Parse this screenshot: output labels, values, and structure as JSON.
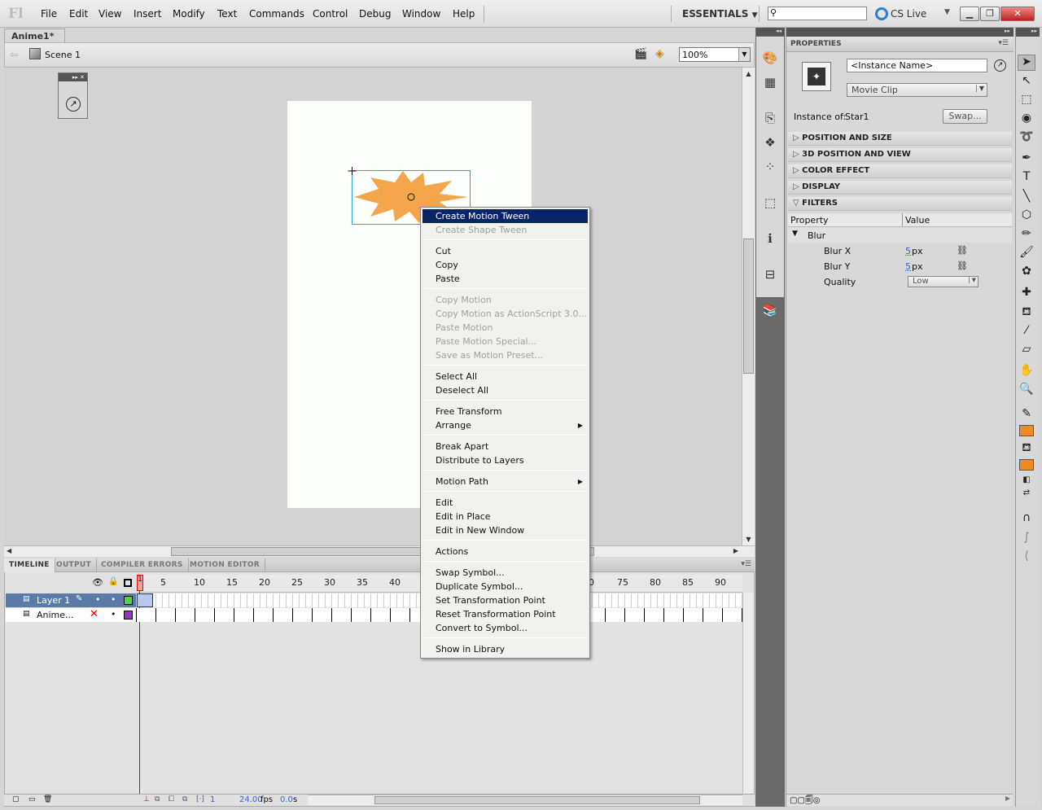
{
  "app": {
    "logo": "Fl",
    "menu": [
      "File",
      "Edit",
      "View",
      "Insert",
      "Modify",
      "Text",
      "Commands",
      "Control",
      "Debug",
      "Window",
      "Help"
    ],
    "workspace": "ESSENTIALS",
    "search_placeholder": "",
    "cslive": "CS Live"
  },
  "document": {
    "tab": "Anime1*",
    "scene": "Scene 1",
    "zoom": "100%"
  },
  "context_menu": [
    {
      "label": "Create Motion Tween",
      "state": "highlighted"
    },
    {
      "label": "Create Shape Tween",
      "state": "disabled"
    },
    {
      "sep": true
    },
    {
      "label": "Cut"
    },
    {
      "label": "Copy"
    },
    {
      "label": "Paste"
    },
    {
      "sep": true
    },
    {
      "label": "Copy Motion",
      "state": "disabled"
    },
    {
      "label": "Copy Motion as ActionScript 3.0...",
      "state": "disabled"
    },
    {
      "label": "Paste Motion",
      "state": "disabled"
    },
    {
      "label": "Paste Motion Special...",
      "state": "disabled"
    },
    {
      "label": "Save as Motion Preset...",
      "state": "disabled"
    },
    {
      "sep": true
    },
    {
      "label": "Select All"
    },
    {
      "label": "Deselect All"
    },
    {
      "sep": true
    },
    {
      "label": "Free Transform"
    },
    {
      "label": "Arrange",
      "submenu": true
    },
    {
      "sep": true
    },
    {
      "label": "Break Apart"
    },
    {
      "label": "Distribute to Layers"
    },
    {
      "sep": true
    },
    {
      "label": "Motion Path",
      "submenu": true
    },
    {
      "sep": true
    },
    {
      "label": "Edit"
    },
    {
      "label": "Edit in Place"
    },
    {
      "label": "Edit in New Window"
    },
    {
      "sep": true
    },
    {
      "label": "Actions"
    },
    {
      "sep": true
    },
    {
      "label": "Swap Symbol..."
    },
    {
      "label": "Duplicate Symbol..."
    },
    {
      "label": "Set Transformation Point"
    },
    {
      "label": "Reset Transformation Point"
    },
    {
      "label": "Convert to Symbol..."
    },
    {
      "sep": true
    },
    {
      "label": "Show in Library"
    }
  ],
  "timeline": {
    "tabs": [
      "TIMELINE",
      "OUTPUT",
      "COMPILER ERRORS",
      "MOTION EDITOR"
    ],
    "frame_numbers": [
      "5",
      "10",
      "15",
      "20",
      "25",
      "30",
      "35",
      "40",
      "0",
      "75",
      "80",
      "85",
      "90"
    ],
    "frame_marker": "1",
    "layers": [
      {
        "name": "Layer 1",
        "color": "#44dd44",
        "selected": true
      },
      {
        "name": "Anime...",
        "color": "#9933cc",
        "selected": false
      }
    ],
    "status": {
      "frame": "1",
      "fps": "24.00",
      "fps_unit": "fps",
      "time": "0.0",
      "time_unit": "s"
    }
  },
  "properties": {
    "title": "PROPERTIES",
    "instance_name_placeholder": "<Instance Name>",
    "type": "Movie Clip",
    "instance_of_label": "Instance of:",
    "instance_of": "Star1",
    "swap_button": "Swap...",
    "sections": [
      "POSITION AND SIZE",
      "3D POSITION AND VIEW",
      "COLOR EFFECT",
      "DISPLAY",
      "FILTERS"
    ],
    "filter_headers": {
      "property": "Property",
      "value": "Value"
    },
    "filter": {
      "name": "Blur",
      "blur_x_label": "Blur X",
      "blur_x": "5",
      "blur_y_label": "Blur Y",
      "blur_y": "5",
      "unit": "px",
      "quality_label": "Quality",
      "quality": "Low"
    }
  },
  "colors": {
    "highlight": "#0a246a",
    "star": "#f4a040",
    "stroke_swatch": "#f08a24",
    "fill_swatch": "#f08a24"
  }
}
